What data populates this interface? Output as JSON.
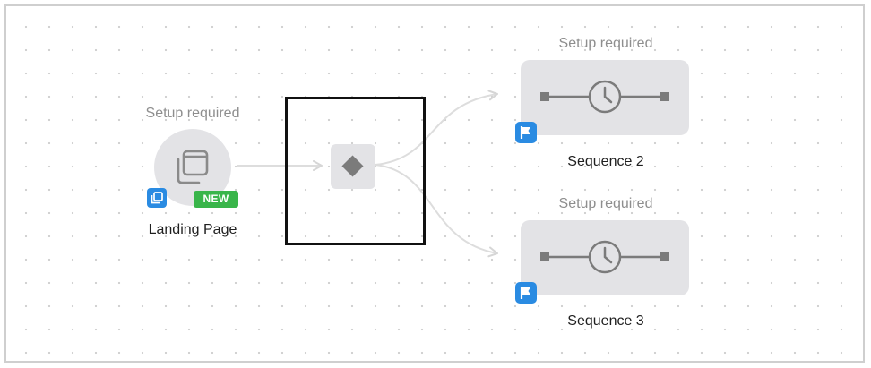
{
  "landing_page": {
    "status": "Setup required",
    "name": "Landing Page",
    "new_badge": "NEW",
    "icon": "page-windows-icon",
    "type_icon": "landing-page-type-icon"
  },
  "split": {
    "icon": "diamond-split-icon",
    "selected": true
  },
  "sequences": [
    {
      "status": "Setup required",
      "name": "Sequence 2",
      "icon": "clock-timeline-icon",
      "badge_icon": "flag-icon"
    },
    {
      "status": "Setup required",
      "name": "Sequence 3",
      "icon": "clock-timeline-icon",
      "badge_icon": "flag-icon"
    }
  ],
  "colors": {
    "node_bg": "#e3e3e6",
    "accent_blue": "#2a8be2",
    "new_green": "#39b54a",
    "connector": "#dddddd",
    "selection": "#111111"
  }
}
